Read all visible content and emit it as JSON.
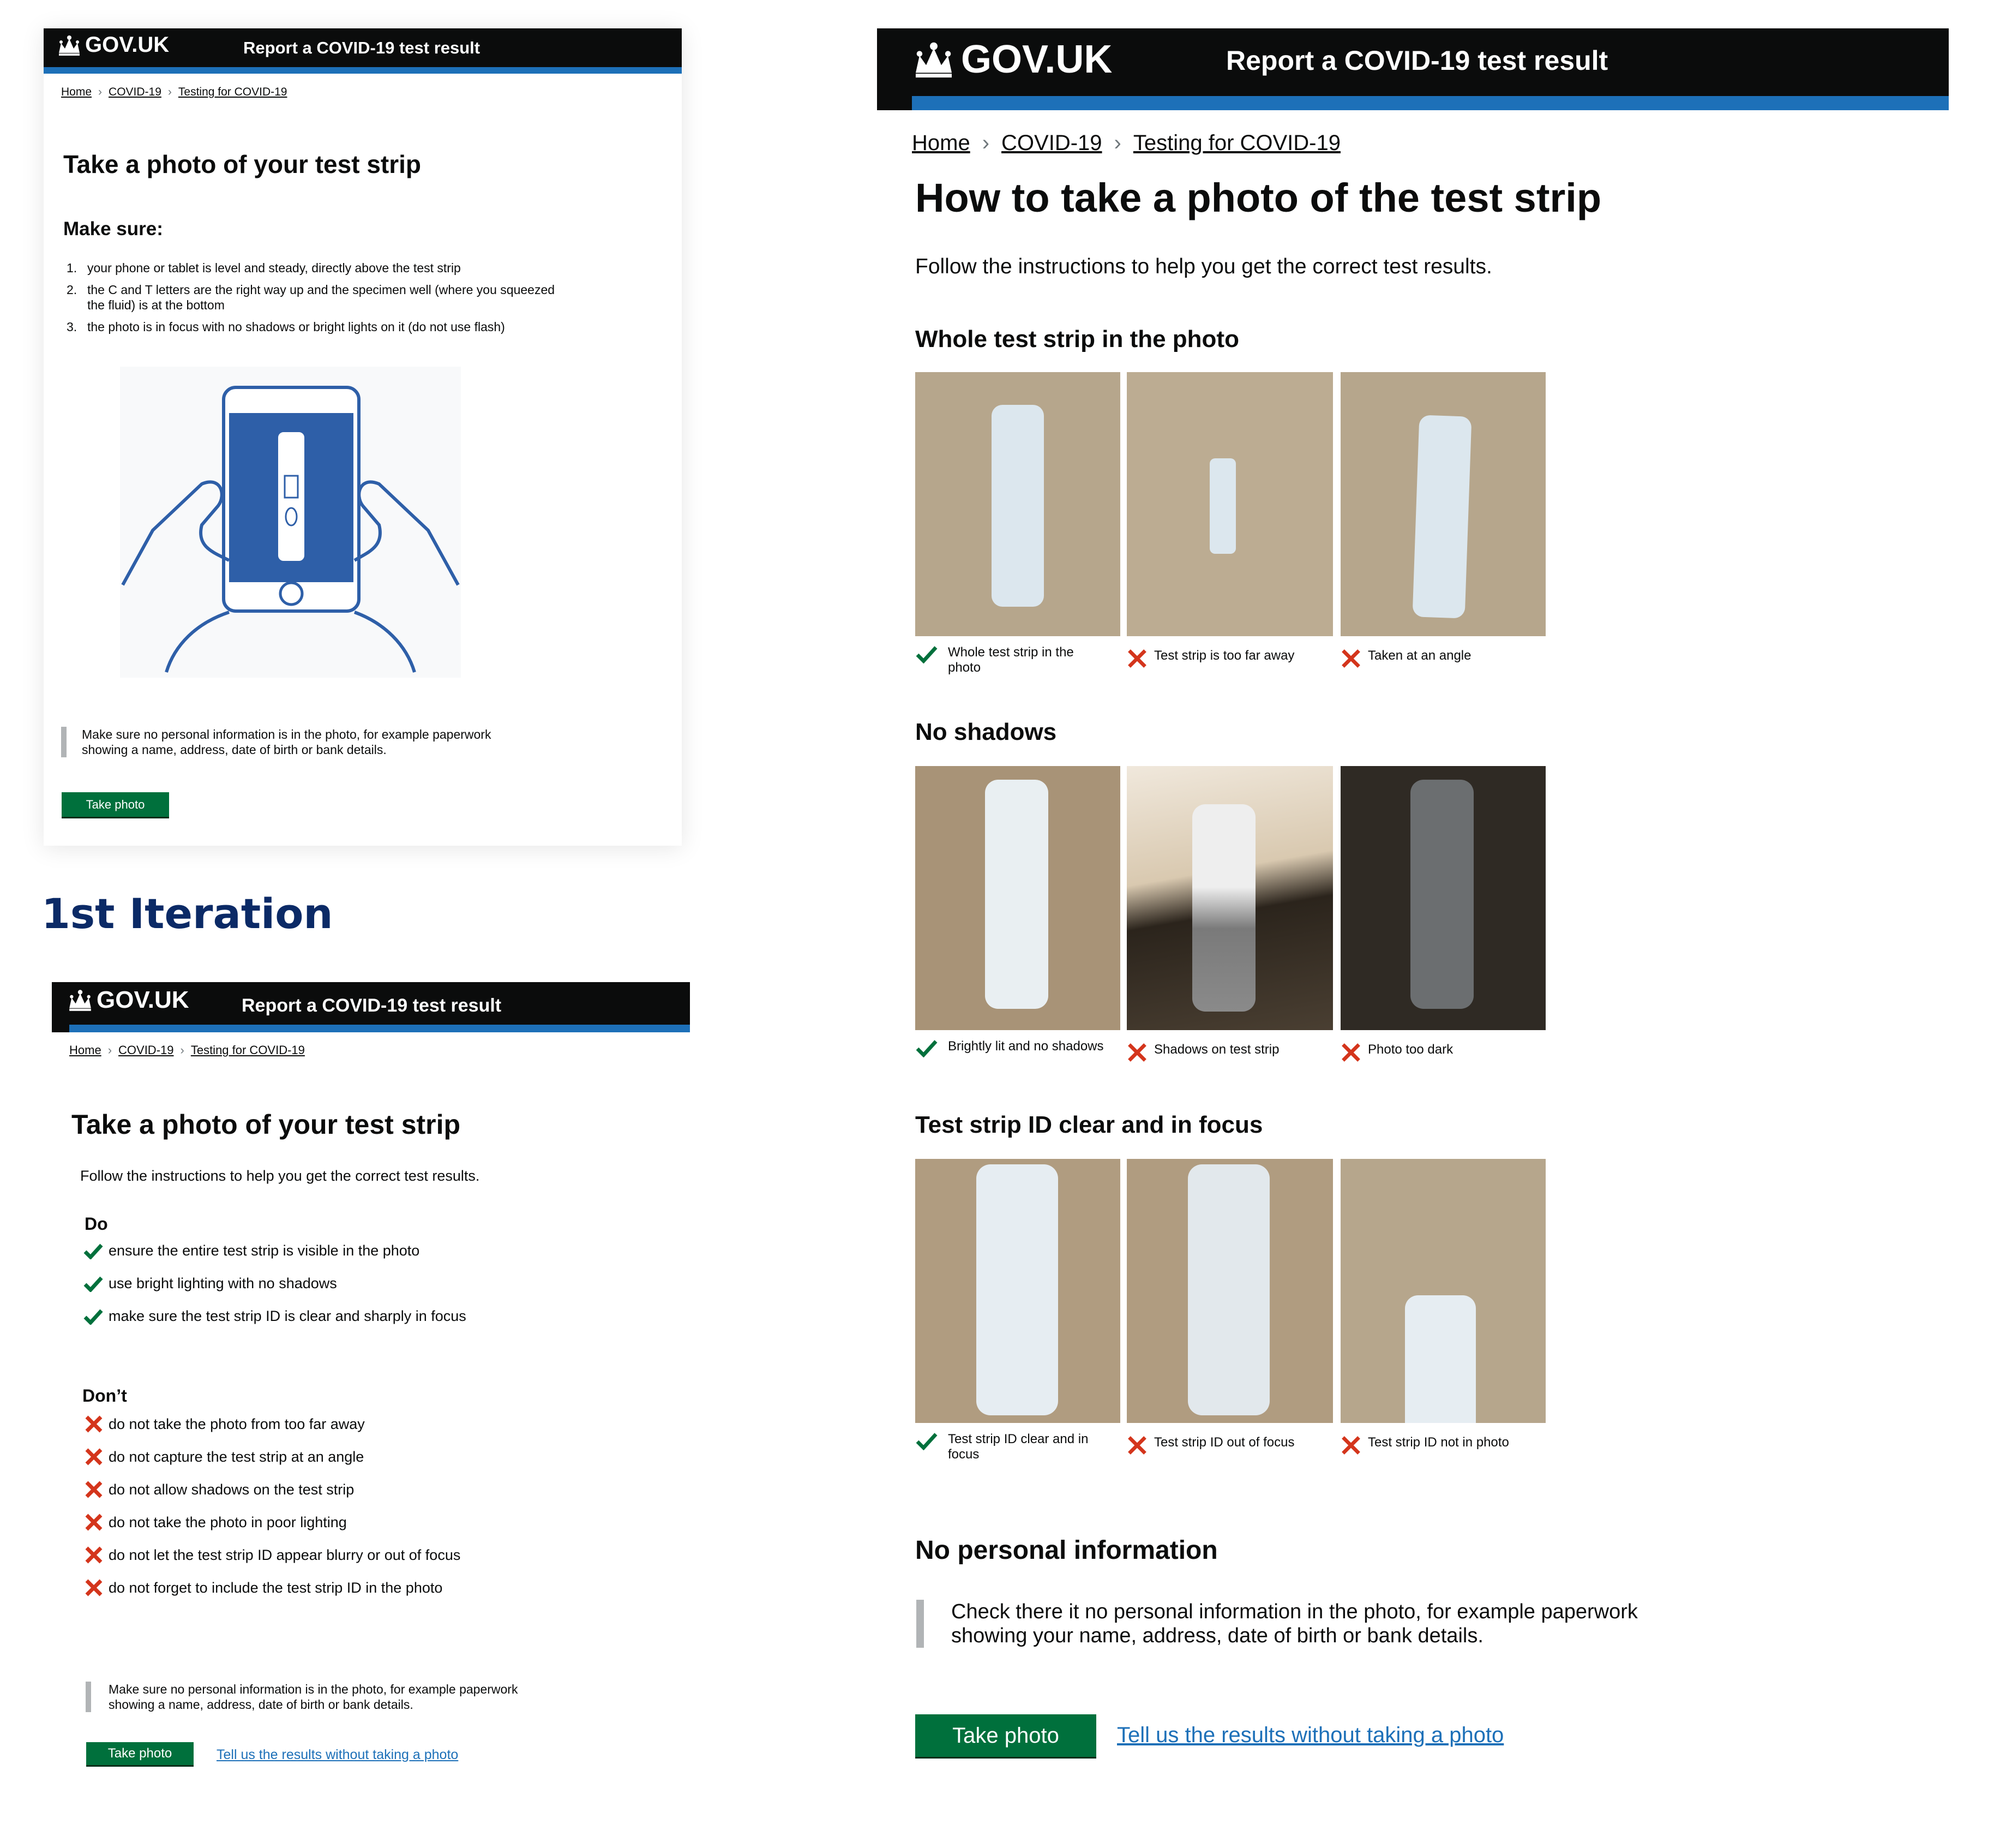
{
  "header": {
    "logo": "GOV.UK",
    "service": "Report a COVID-19 test result"
  },
  "breadcrumbs": [
    "Home",
    "COVID-19",
    "Testing for COVID-19"
  ],
  "panel_a": {
    "title": "Take a photo of your test strip",
    "make_sure": "Make sure:",
    "steps": [
      "your phone or tablet is level and steady, directly above the test strip",
      "the C and T letters are the right way up and the specimen well (where you squeezed the fluid) is at the bottom",
      "the photo is in focus with no shadows or bright lights on it (do not use flash)"
    ],
    "step_numbers": [
      "1.",
      "2.",
      "3."
    ],
    "inset": "Make sure no personal information is in the photo, for example paperwork showing a name, address, date of birth or bank details.",
    "button": "Take photo"
  },
  "iteration_label": "1st Iteration",
  "panel_b": {
    "title": "Take a photo of your test strip",
    "intro": "Follow the instructions to help you get the correct test results.",
    "do_heading": "Do",
    "do_items": [
      "ensure the entire test strip is visible in the photo",
      "use bright lighting with no shadows",
      "make sure the test strip ID is clear and sharply in focus"
    ],
    "dont_heading": "Don’t",
    "dont_items": [
      "do not take the photo from too far away",
      "do not capture the test strip at an angle",
      "do not allow shadows on the test strip",
      "do not take the photo in poor lighting",
      "do not let the test strip ID appear blurry or out of focus",
      "do not forget to include the test strip ID in the photo"
    ],
    "inset": "Make sure no personal information is in the photo, for example paperwork showing a name, address, date of birth or bank details.",
    "button": "Take photo",
    "link": "Tell us the results without taking a photo"
  },
  "panel_c": {
    "title": "How to take a photo of the test strip",
    "intro": "Follow the instructions to help you get the correct test results.",
    "sections": [
      {
        "heading": "Whole test strip in the photo",
        "items": [
          {
            "caption": "Whole test strip in the photo",
            "ok": true
          },
          {
            "caption": "Test strip is too far away",
            "ok": false
          },
          {
            "caption": "Taken at an angle",
            "ok": false
          }
        ]
      },
      {
        "heading": "No shadows",
        "items": [
          {
            "caption": "Brightly lit and no shadows",
            "ok": true
          },
          {
            "caption": "Shadows on test strip",
            "ok": false
          },
          {
            "caption": "Photo too dark",
            "ok": false
          }
        ]
      },
      {
        "heading": "Test strip ID clear and in focus",
        "items": [
          {
            "caption": "Test strip ID clear and in focus",
            "ok": true
          },
          {
            "caption": "Test strip ID out of focus",
            "ok": false
          },
          {
            "caption": "Test strip ID not in photo",
            "ok": false
          }
        ]
      }
    ],
    "pi_heading": "No personal information",
    "inset": "Check there it no personal information in the photo, for example paperwork showing your name, address, date of birth or bank details.",
    "button": "Take photo",
    "link": "Tell us the results without taking a photo"
  },
  "colors": {
    "header_bg": "#0b0c0c",
    "header_stripe": "#1d70b8",
    "button_green": "#00703c",
    "link_blue": "#1d70b8",
    "tick_green": "#00703c",
    "cross_red": "#d4351c"
  }
}
